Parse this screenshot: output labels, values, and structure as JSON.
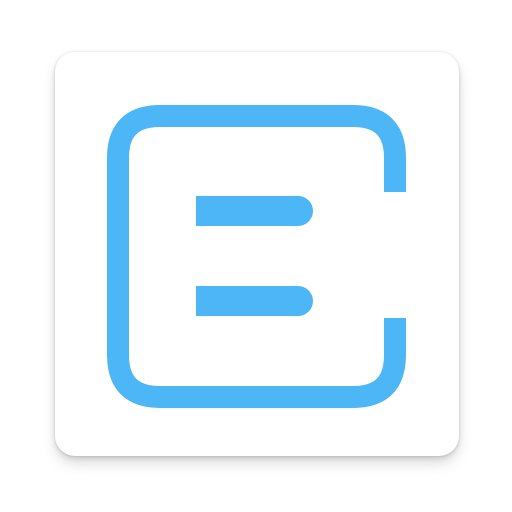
{
  "app_icon": {
    "icon": "letter-e-bracket-icon",
    "colors": {
      "background": "#ffffff",
      "tile": "#ffffff",
      "accent": "#4db6f7"
    }
  }
}
